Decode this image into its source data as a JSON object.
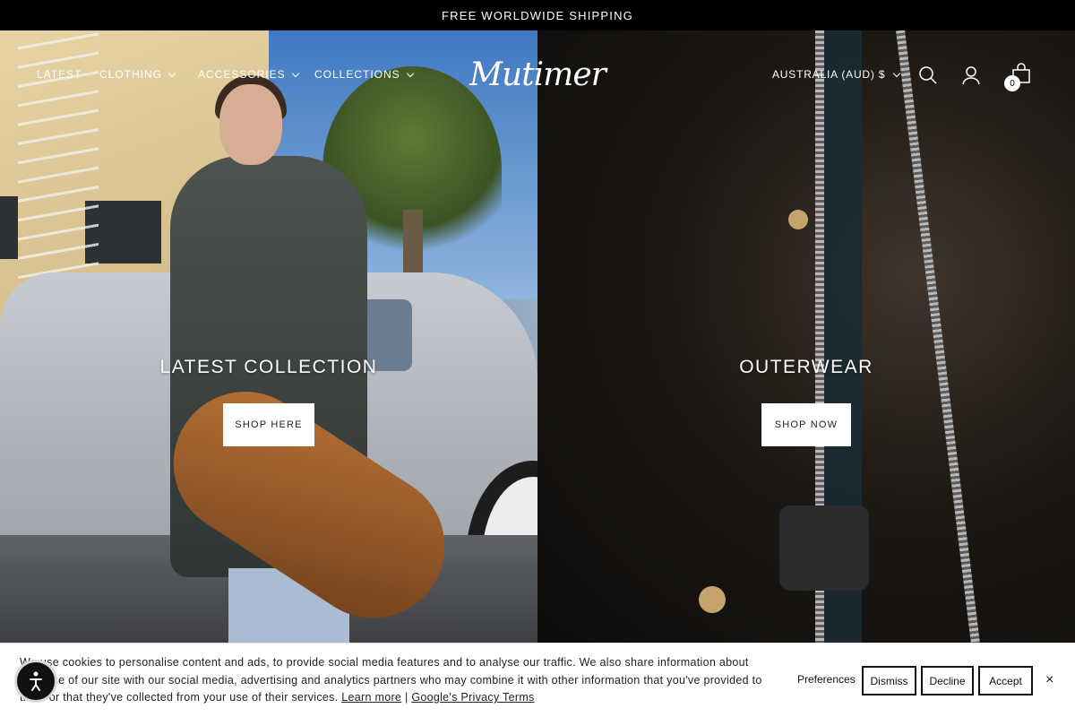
{
  "announcement": {
    "text": "FREE WORLDWIDE SHIPPING"
  },
  "nav": {
    "items": [
      {
        "label": "LATEST",
        "has_dropdown": false
      },
      {
        "label": "CLOTHING",
        "has_dropdown": true
      },
      {
        "label": "ACCESSORIES",
        "has_dropdown": true
      },
      {
        "label": "COLLECTIONS",
        "has_dropdown": true
      }
    ],
    "logo_text": "Mutimer",
    "currency": "AUSTRALIA (AUD) $",
    "icons": [
      "search-icon",
      "account-icon",
      "cart-icon"
    ],
    "cart_count": "0"
  },
  "hero": {
    "left": {
      "title": "LATEST COLLECTION",
      "button": "SHOP HERE"
    },
    "right": {
      "title": "OUTERWEAR",
      "button": "SHOP NOW"
    }
  },
  "cookie": {
    "text": "We use cookies to personalise content and ads, to provide social media features and to analyse our traffic. We also share information about your use of our site with our social media, advertising and analytics partners who may combine it with other information that you've provided to them or that they've collected from your use of their services.",
    "learn_more": "Learn more",
    "separator": "|",
    "privacy": "Google's Privacy Terms",
    "preferences": "Preferences",
    "dismiss": "Dismiss",
    "decline": "Decline",
    "accept": "Accept",
    "close": "×"
  },
  "colors": {
    "black": "#000000",
    "white": "#ffffff"
  }
}
